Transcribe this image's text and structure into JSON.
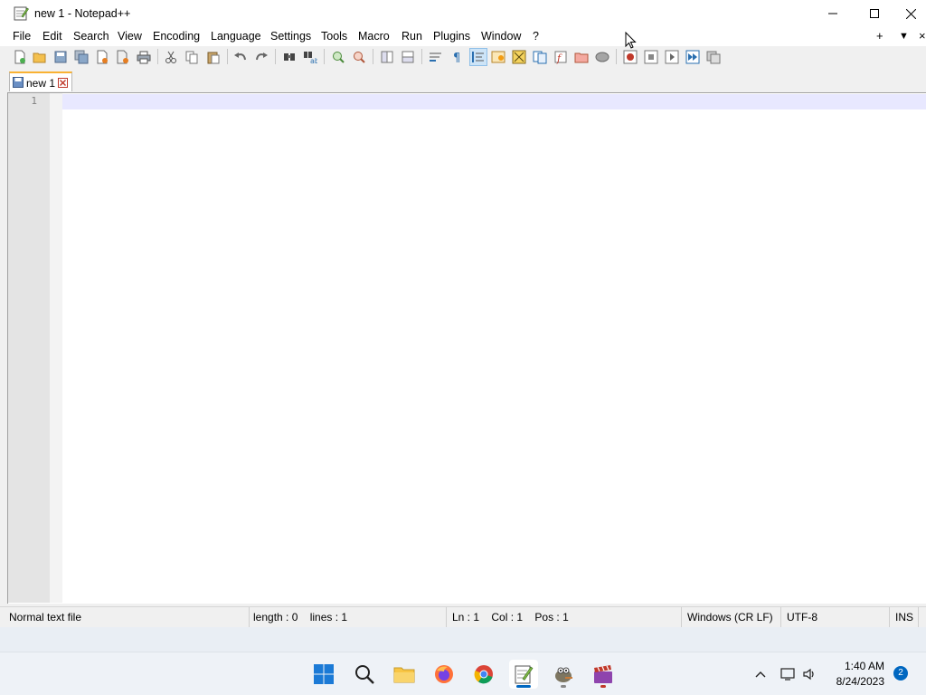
{
  "window": {
    "title": "new 1 - Notepad++"
  },
  "menubar": {
    "items": [
      "File",
      "Edit",
      "Search",
      "View",
      "Encoding",
      "Language",
      "Settings",
      "Tools",
      "Macro",
      "Run",
      "Plugins",
      "Window",
      "?"
    ],
    "right": {
      "add": "+",
      "dropdown": "▼",
      "close": "×"
    }
  },
  "toolbar": {
    "icons": [
      "new-file-icon",
      "open-file-icon",
      "save-icon",
      "save-all-icon",
      "close-icon",
      "close-all-icon",
      "print-icon",
      "cut-icon",
      "copy-icon",
      "paste-icon",
      "undo-icon",
      "redo-icon",
      "find-icon",
      "replace-icon",
      "zoom-in-icon",
      "zoom-out-icon",
      "sync-vertical-icon",
      "sync-horizontal-icon",
      "word-wrap-icon",
      "show-all-chars-icon",
      "indent-guide-icon",
      "doc-map-icon",
      "function-list-icon",
      "folder-workspace-icon",
      "monitoring-icon",
      "doc-list-icon",
      "macro-record-icon",
      "macro-stop-icon",
      "macro-play-icon",
      "macro-run-multiple-icon",
      "macro-save-icon"
    ]
  },
  "tabs": [
    {
      "label": "new 1",
      "active": true
    }
  ],
  "editor": {
    "line_numbers": [
      "1"
    ],
    "content": ""
  },
  "statusbar": {
    "file_type": "Normal text file",
    "length": "length : 0",
    "lines": "lines : 1",
    "ln": "Ln : 1",
    "col": "Col : 1",
    "pos": "Pos : 1",
    "eol": "Windows (CR LF)",
    "encoding": "UTF-8",
    "mode": "INS"
  },
  "taskbar": {
    "apps": [
      "start",
      "search",
      "file-explorer",
      "firefox",
      "chrome",
      "notepad-plus-plus",
      "gimp",
      "clapper"
    ],
    "clock_time": "1:40 AM",
    "clock_date": "8/24/2023",
    "notification_count": "2"
  },
  "colors": {
    "caret_line": "#e8e8ff",
    "tab_accent": "#f9b233",
    "taskbar_accent": "#0067c0"
  }
}
